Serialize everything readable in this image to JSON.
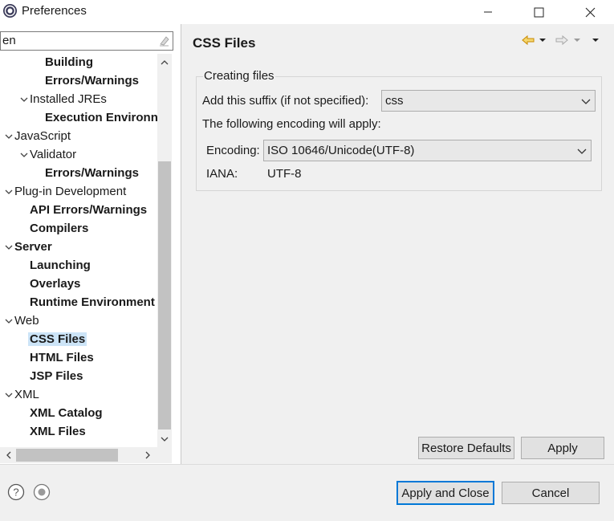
{
  "window": {
    "title": "Preferences",
    "icons": {
      "app": "eclipse-icon",
      "minimize": "minimize-icon",
      "maximize": "maximize-icon",
      "close": "close-icon"
    }
  },
  "filter": {
    "value": "en",
    "clear_icon": "clear-filter-icon"
  },
  "tree": [
    {
      "label": "Building",
      "bold": true,
      "twisty": ""
    },
    {
      "label": "Errors/Warnings",
      "bold": true,
      "twisty": ""
    },
    {
      "label": "Installed JREs",
      "bold": false,
      "twisty": "expanded"
    },
    {
      "label": "Execution Environn",
      "bold": true,
      "twisty": ""
    },
    {
      "label": "JavaScript",
      "bold": false,
      "twisty": "expanded"
    },
    {
      "label": "Validator",
      "bold": false,
      "twisty": "expanded"
    },
    {
      "label": "Errors/Warnings",
      "bold": true,
      "twisty": ""
    },
    {
      "label": "Plug-in Development",
      "bold": false,
      "twisty": "expanded"
    },
    {
      "label": "API Errors/Warnings",
      "bold": true,
      "twisty": ""
    },
    {
      "label": "Compilers",
      "bold": true,
      "twisty": ""
    },
    {
      "label": "Server",
      "bold": true,
      "twisty": "expanded"
    },
    {
      "label": "Launching",
      "bold": true,
      "twisty": ""
    },
    {
      "label": "Overlays",
      "bold": true,
      "twisty": ""
    },
    {
      "label": "Runtime Environment",
      "bold": true,
      "twisty": ""
    },
    {
      "label": "Web",
      "bold": false,
      "twisty": "expanded"
    },
    {
      "label": "CSS Files",
      "bold": true,
      "twisty": "",
      "selected": true
    },
    {
      "label": "HTML Files",
      "bold": true,
      "twisty": ""
    },
    {
      "label": "JSP Files",
      "bold": true,
      "twisty": ""
    },
    {
      "label": "XML",
      "bold": false,
      "twisty": "expanded"
    },
    {
      "label": "XML Catalog",
      "bold": true,
      "twisty": ""
    },
    {
      "label": "XML Files",
      "bold": true,
      "twisty": ""
    }
  ],
  "page": {
    "title": "CSS Files",
    "nav": {
      "back_icon": "back-arrow-icon",
      "back_menu_icon": "back-dropdown-icon",
      "forward_icon": "forward-arrow-icon",
      "forward_menu_icon": "forward-dropdown-icon",
      "view_menu_icon": "view-menu-icon"
    },
    "group_title": "Creating files",
    "suffix_label": "Add this suffix (if not specified):",
    "suffix_value": "css",
    "encoding_note": "The following encoding will apply:",
    "encoding_label": "Encoding:",
    "encoding_value": "ISO 10646/Unicode(UTF-8)",
    "iana_label": "IANA:",
    "iana_value": "UTF-8",
    "restore_defaults": "Restore Defaults",
    "apply": "Apply"
  },
  "footer": {
    "help_icon": "help-icon",
    "record_icon": "record-macro-icon",
    "apply_close": "Apply and Close",
    "cancel": "Cancel"
  },
  "colors": {
    "selection": "#cce4f7",
    "accent": "#0078d7",
    "nav_arrow": "#e8a317"
  }
}
